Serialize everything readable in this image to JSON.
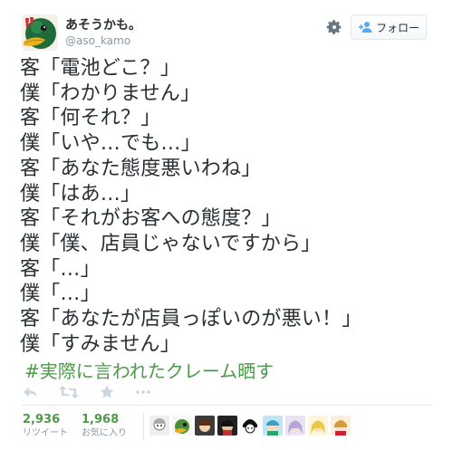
{
  "user": {
    "display_name": "あそうかも。",
    "handle": "@aso_kamo"
  },
  "follow_button": {
    "label": "フォロー"
  },
  "tweet": {
    "lines": [
      "客「電池どこ？」",
      "僕「わかりません」",
      "客「何それ？」",
      "僕「いや…でも…」",
      "客「あなた態度悪いわね」",
      "僕「はあ…」",
      "客「それがお客への態度？」",
      "僕「僕、店員じゃないですから」",
      "客「…」",
      "僕「…」",
      "客「あなたが店員っぽいのが悪い！」",
      "僕「すみません」"
    ],
    "hashtag": "#実際に言われたクレーム晒す"
  },
  "stats": {
    "retweets": {
      "count": "2,936",
      "label": "リツイート"
    },
    "favorites": {
      "count": "1,968",
      "label": "お気に入り"
    }
  },
  "icons": {
    "settings": "gear-icon",
    "follow": "person-add-icon",
    "reply": "reply-icon",
    "retweet": "retweet-icon",
    "favorite": "star-icon",
    "more": "more-icon"
  },
  "colors": {
    "link_green": "#4b9a47",
    "text": "#292f33",
    "muted": "#8899a6",
    "action_gray": "#ccd6dd",
    "follow_blue": "#55acee"
  }
}
